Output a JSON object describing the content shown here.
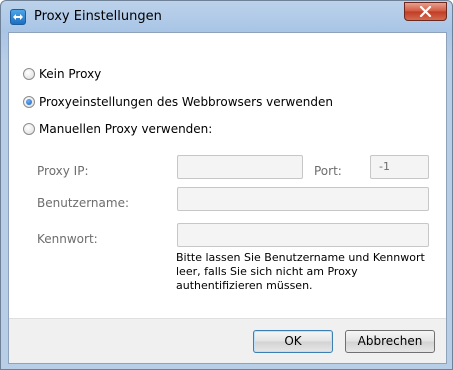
{
  "window": {
    "title": "Proxy Einstellungen"
  },
  "options": [
    {
      "label": "Kein Proxy",
      "checked": false
    },
    {
      "label": "Proxyeinstellungen des Webbrowsers verwenden",
      "checked": true
    },
    {
      "label": "Manuellen Proxy verwenden:",
      "checked": false
    }
  ],
  "fields": {
    "proxy_ip_label": "Proxy IP:",
    "proxy_ip_value": "",
    "port_label": "Port:",
    "port_value": "-1",
    "username_label": "Benutzername:",
    "username_value": "",
    "password_label": "Kennwort:",
    "password_value": ""
  },
  "note": "Bitte lassen Sie Benutzername und Kennwort leer, falls Sie sich nicht am Proxy authentifizieren müssen.",
  "buttons": {
    "ok": "OK",
    "cancel": "Abbrechen"
  },
  "icons": {
    "app": "teamviewer-icon",
    "close": "close-icon"
  }
}
